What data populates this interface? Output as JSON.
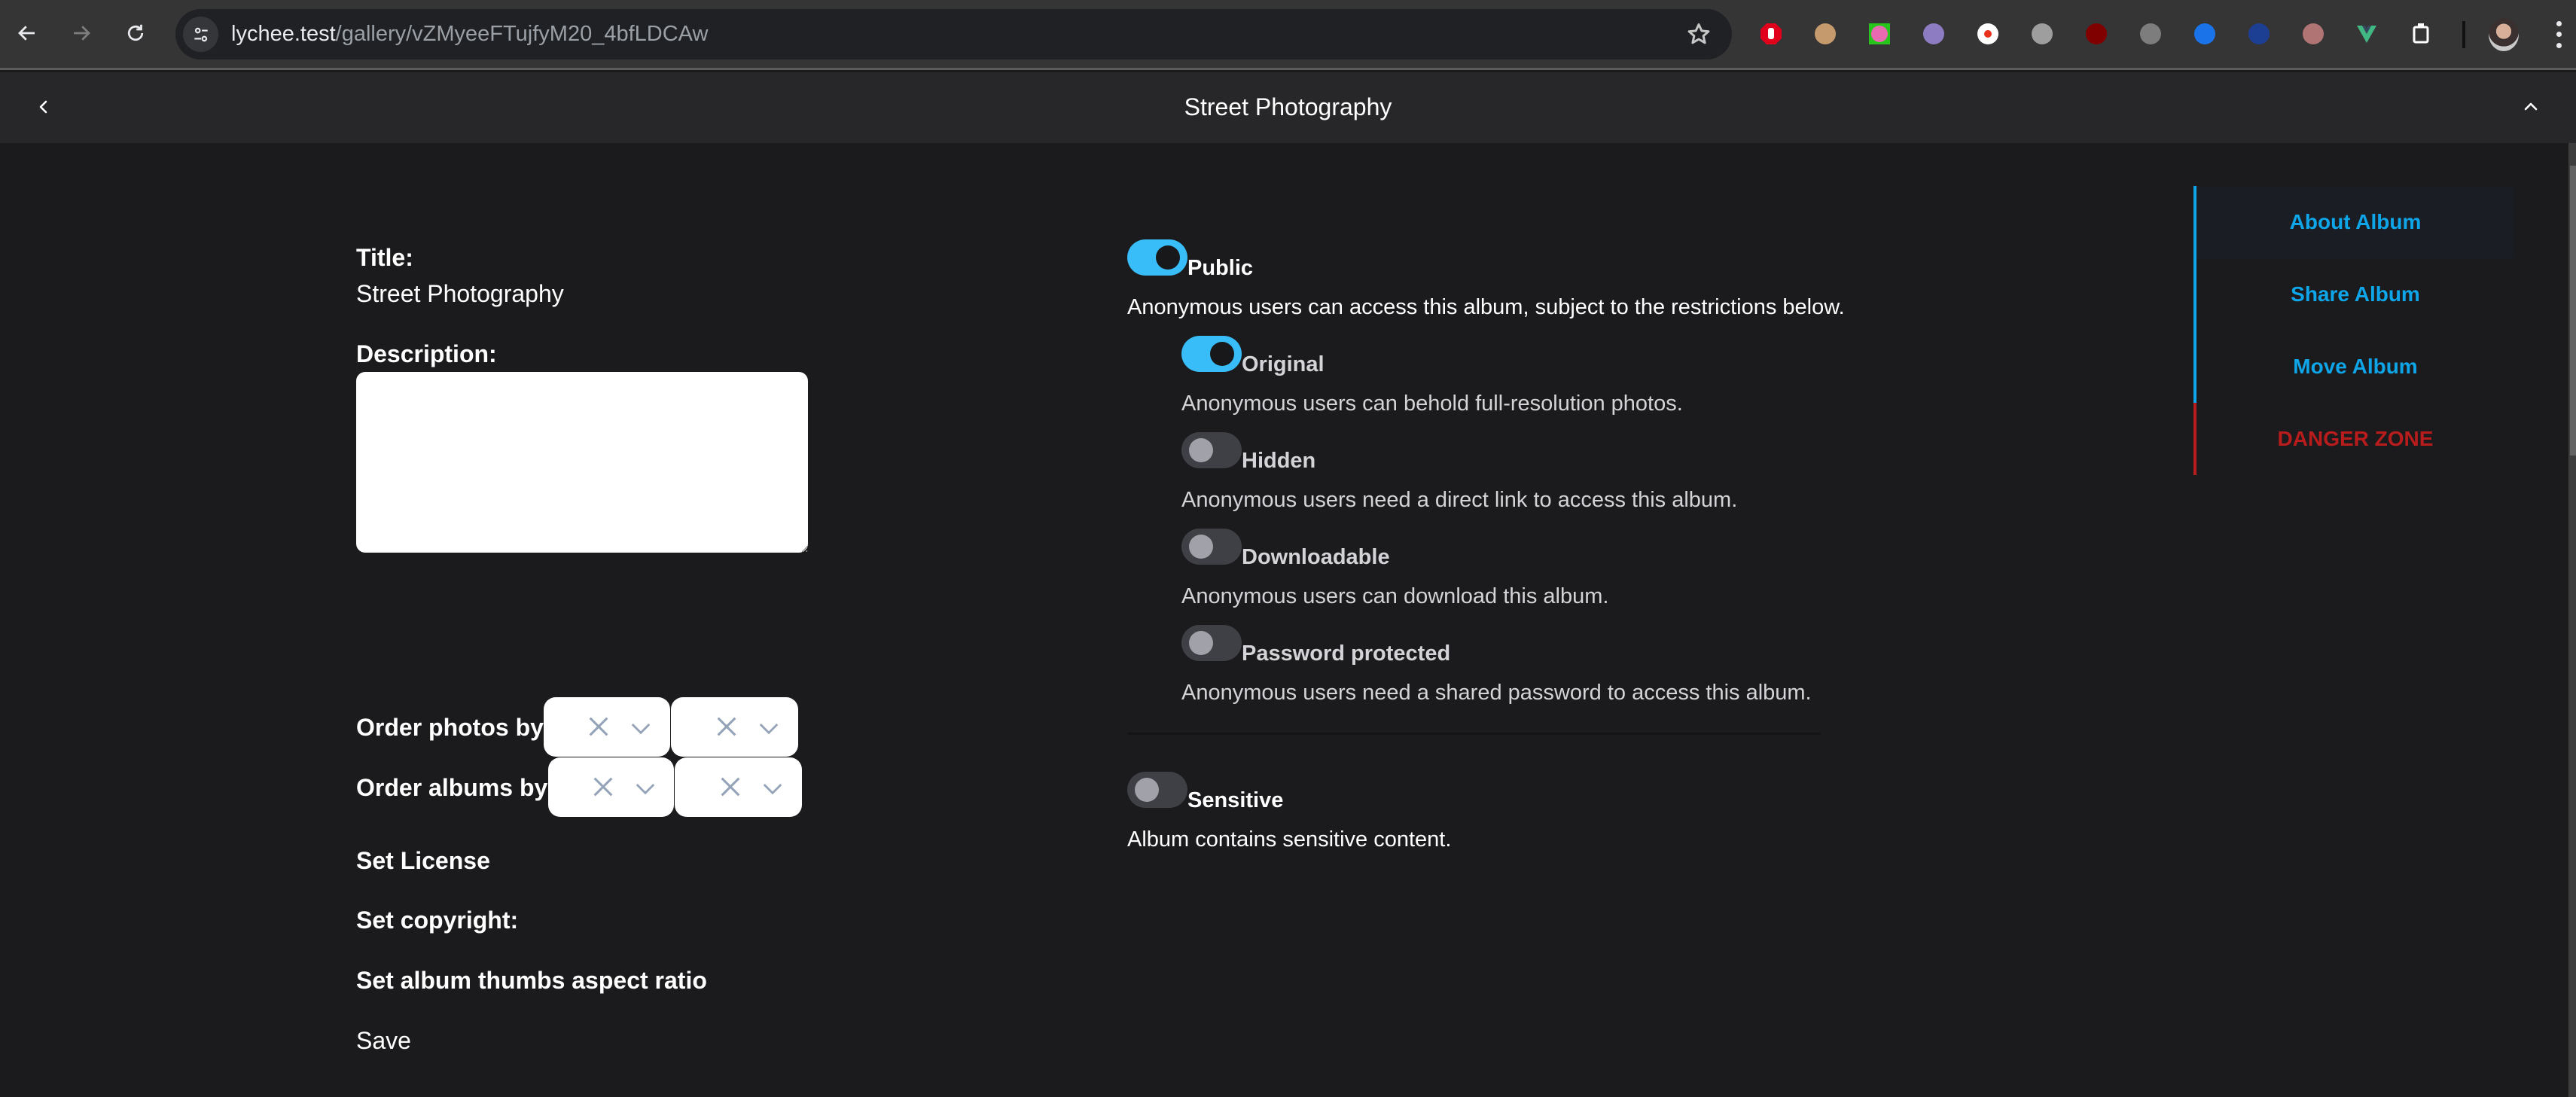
{
  "browser": {
    "url_host": "lychee.test",
    "url_path": "/gallery/vZMyeeFTujfyM20_4bfLDCAw",
    "extensions": [
      {
        "name": "adblock-icon",
        "color": "#e0001b"
      },
      {
        "name": "glasses-face-icon",
        "color": "#c59b6d"
      },
      {
        "name": "candy-icon",
        "color": "#27c41e"
      },
      {
        "name": "octocat-icon",
        "color": "#8e7cc3"
      },
      {
        "name": "record-icon",
        "color": "#e8321c"
      },
      {
        "name": "joystick-icon",
        "color": "#9e9e9e"
      },
      {
        "name": "ublock-icon",
        "color": "#800000"
      },
      {
        "name": "csp-shield-icon",
        "color": "#7d7d7d"
      },
      {
        "name": "screen-capture-icon",
        "color": "#1a73e8"
      },
      {
        "name": "eu-lock-icon",
        "color": "#1c3f94"
      },
      {
        "name": "cookie-icon",
        "color": "#b07474"
      },
      {
        "name": "vue-devtools-icon",
        "color": "#41b883"
      },
      {
        "name": "extensions-puzzle-icon",
        "color": "#ffffff"
      }
    ]
  },
  "header": {
    "title": "Street Photography"
  },
  "form": {
    "title_label": "Title:",
    "title_value": "Street Photography",
    "description_label": "Description:",
    "description_value": "",
    "order_photos_label": "Order photos by",
    "order_albums_label": "Order albums by",
    "order_photos_column": "",
    "order_photos_direction": "",
    "order_albums_column": "",
    "order_albums_direction": "",
    "license_label": "Set License",
    "copyright_label": "Set copyright:",
    "aspect_ratio_label": "Set album thumbs aspect ratio",
    "save_label": "Save"
  },
  "visibility": {
    "public": {
      "label": "Public",
      "description": "Anonymous users can access this album, subject to the restrictions below.",
      "enabled": true
    },
    "original": {
      "label": "Original",
      "description": "Anonymous users can behold full-resolution photos.",
      "enabled": true
    },
    "hidden": {
      "label": "Hidden",
      "description": "Anonymous users need a direct link to access this album.",
      "enabled": false
    },
    "downloadable": {
      "label": "Downloadable",
      "description": "Anonymous users can download this album.",
      "enabled": false
    },
    "password": {
      "label": "Password protected",
      "description": "Anonymous users need a shared password to access this album.",
      "enabled": false
    },
    "sensitive": {
      "label": "Sensitive",
      "description": "Album contains sensitive content.",
      "enabled": false
    }
  },
  "side_nav": {
    "items": [
      {
        "label": "About Album",
        "active": true
      },
      {
        "label": "Share Album",
        "active": false
      },
      {
        "label": "Move Album",
        "active": false
      },
      {
        "label": "DANGER ZONE",
        "active": false
      }
    ]
  },
  "colors": {
    "accent": "#38bdf8",
    "nav_link": "#0ea5e9",
    "danger": "#b91c1c",
    "background": "#1b1b1d",
    "header_bg": "#27272a"
  }
}
